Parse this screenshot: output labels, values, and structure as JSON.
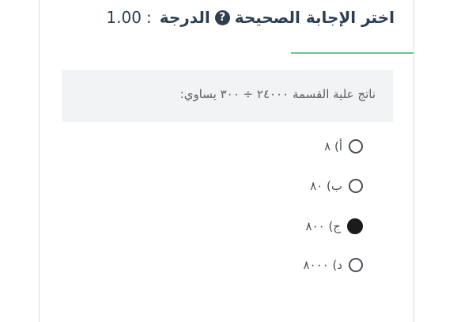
{
  "question_header": {
    "title": "اختر الإجابة الصحيحة",
    "grade_label": "الدرجة",
    "grade_separator": ":",
    "grade_value": "1.00",
    "help_icon": "?"
  },
  "question": {
    "text": "ناتج علية القسمة ٢٤٠٠٠ ÷ ٣٠٠ يساوي:"
  },
  "options": [
    {
      "label": "أ) ٨",
      "selected": false
    },
    {
      "label": "ب) ٨٠",
      "selected": false
    },
    {
      "label": "ج) ٨٠٠",
      "selected": true
    },
    {
      "label": "د) ٨٠٠٠",
      "selected": false
    }
  ],
  "colors": {
    "title": "#2c3e50",
    "underline": "#6cc48f",
    "question_bg": "#f2f3f5",
    "text": "#4a4f55"
  }
}
